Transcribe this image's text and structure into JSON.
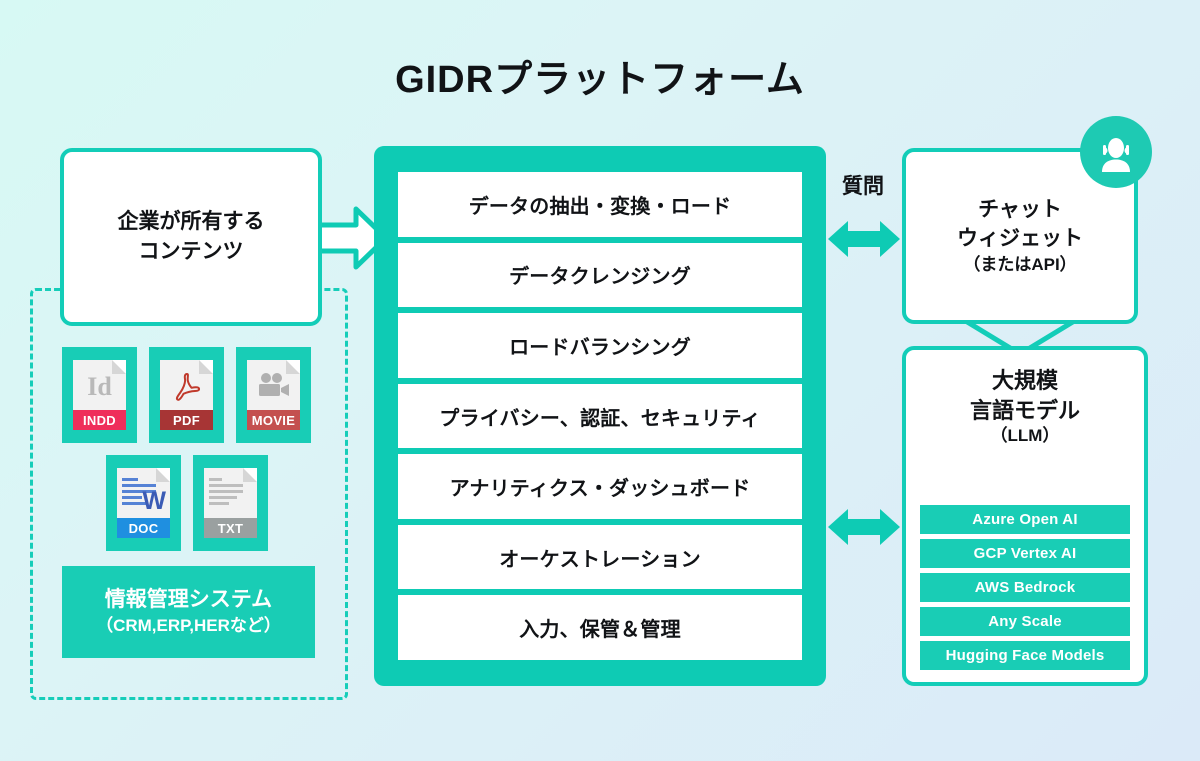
{
  "title": "GIDRプラットフォーム",
  "colors": {
    "teal": "#0ecbb4",
    "teal_border": "#13cdb8",
    "teal_fill": "#19cdb5",
    "bg_start": "#d7f9f4",
    "bg_end": "#dbeaf8",
    "text": "#111316"
  },
  "left": {
    "owned_content": {
      "line1": "企業が所有する",
      "line2": "コンテンツ"
    },
    "files": [
      {
        "label": "INDD",
        "icon": "indesign-file-icon",
        "band_color": "#ef2e5b"
      },
      {
        "label": "PDF",
        "icon": "pdf-file-icon",
        "band_color": "#a73535"
      },
      {
        "label": "MOVIE",
        "icon": "movie-file-icon",
        "band_color": "#c4504f"
      },
      {
        "label": "DOC",
        "icon": "word-file-icon",
        "band_color": "#1f8fe0"
      },
      {
        "label": "TXT",
        "icon": "text-file-icon",
        "band_color": "#9aa0a0"
      }
    ],
    "info_system": {
      "line1": "情報管理システム",
      "line2": "（CRM,ERP,HERなど）"
    }
  },
  "flow": {
    "left_arrow_icon": "arrow-right-icon",
    "question_label": "質問",
    "top_double_arrow_icon": "double-arrow-horizontal-icon",
    "bottom_double_arrow_icon": "double-arrow-horizontal-icon",
    "chat_to_llm_connector_icon": "chevron-down-connector-icon"
  },
  "platform": {
    "rows": [
      "データの抽出・変換・ロード",
      "データクレンジング",
      "ロードバランシング",
      "プライバシー、認証、セキュリティ",
      "アナリティクス・ダッシュボード",
      "オーケストレーション",
      "入力、保管＆管理"
    ]
  },
  "right": {
    "chat_widget": {
      "line1": "チャット",
      "line2": "ウィジェット",
      "line3": "（またはAPI）",
      "avatar_icon": "support-agent-icon"
    },
    "llm": {
      "line1": "大規模",
      "line2": "言語モデル",
      "line3": "（LLM）",
      "providers": [
        "Azure Open AI",
        "GCP Vertex AI",
        "AWS Bedrock",
        "Any Scale",
        "Hugging Face Models"
      ]
    }
  }
}
